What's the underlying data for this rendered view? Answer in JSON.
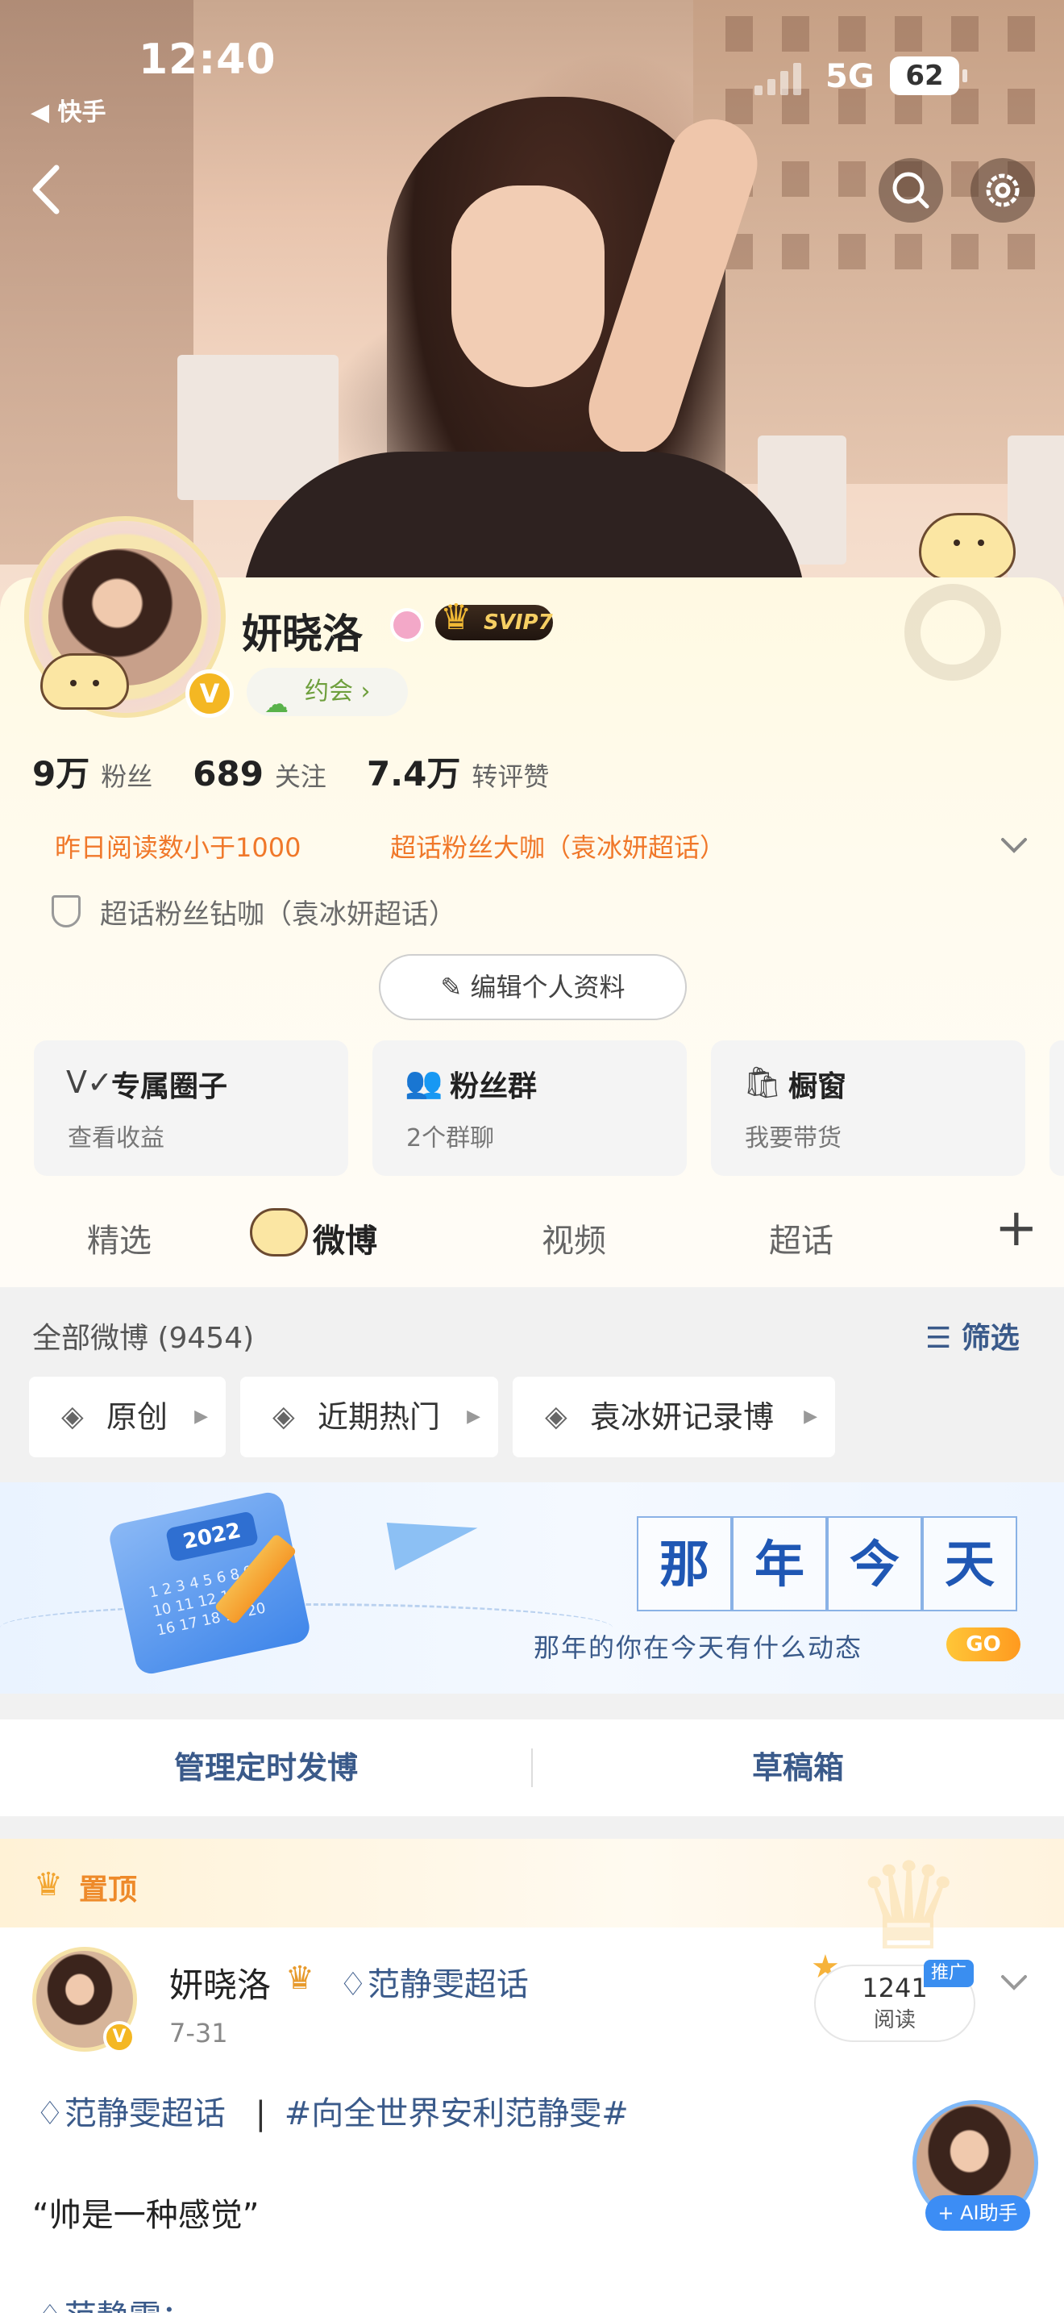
{
  "status_bar": {
    "time": "12:40",
    "back_app": "◀ 快手",
    "network": "5G",
    "battery": "62"
  },
  "nav": {
    "back_icon": "chevron-left-icon",
    "search_icon": "search-icon",
    "settings_icon": "gear-icon"
  },
  "profile": {
    "name": "妍晓洛",
    "svip": "SVIP7",
    "date_chip": "约会 ›",
    "stats": [
      {
        "num": "9万",
        "label": "粉丝"
      },
      {
        "num": "689",
        "label": "关注"
      },
      {
        "num": "7.4万",
        "label": "转评赞"
      }
    ],
    "tags": [
      "昨日阅读数小于1000",
      "超话粉丝大咖（袁冰妍超话）"
    ],
    "badge_line": "超话粉丝钻咖（袁冰妍超话）",
    "edit_button": "✎ 编辑个人资料"
  },
  "tools": [
    {
      "icon": "V✓",
      "title": "专属圈子",
      "sub": "查看收益"
    },
    {
      "icon": "👥",
      "title": "粉丝群",
      "sub": "2个群聊"
    },
    {
      "icon": "🛍",
      "title": "橱窗",
      "sub": "我要带货"
    }
  ],
  "tabs": [
    {
      "label": "精选"
    },
    {
      "label": "微博"
    },
    {
      "label": "视频"
    },
    {
      "label": "超话"
    }
  ],
  "tab_plus": "+",
  "feed": {
    "all_count": "全部微博 (9454)",
    "filter": "☰ 筛选",
    "chips": [
      "原创",
      "近期热门",
      "袁冰妍记录博"
    ]
  },
  "banner": {
    "year": "2022",
    "cal_nums": "1 2 3 4 5 6 8 9 10 11 12 13 15 16 17 18 19 20",
    "chars": [
      "那",
      "年",
      "今",
      "天"
    ],
    "subtitle": "那年的你在今天有什么动态",
    "go": "GO"
  },
  "actions": {
    "scheduled": "管理定时发博",
    "drafts": "草稿箱"
  },
  "post": {
    "pinned": "置顶",
    "author": "妍晓洛",
    "topic": "♢范静雯超话",
    "date": "7-31",
    "reads": "1241",
    "reads_label": "阅读",
    "promo": "推广",
    "line1_topic": "♢范静雯超话",
    "line1_sep": "|",
    "line1_hashtag": "#向全世界安利范静雯#",
    "quote": "“帅是一种感觉”",
    "peek": "♢范静雯："
  },
  "ai_assistant": "+ AI助手"
}
